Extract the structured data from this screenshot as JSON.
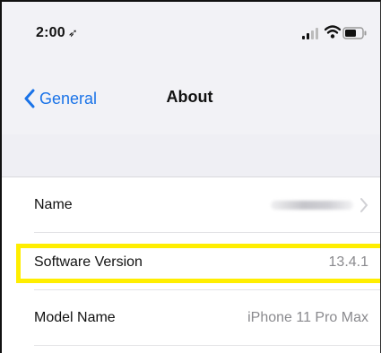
{
  "status_bar": {
    "time": "2:00",
    "location_arrow": "location-arrow-icon",
    "icons": [
      "signal-icon",
      "wifi-icon",
      "battery-icon"
    ]
  },
  "nav": {
    "back_label": "General",
    "title": "About"
  },
  "rows": [
    {
      "label": "Name",
      "value": "",
      "value_obscured": true
    },
    {
      "label": "Software Version",
      "value": "13.4.1"
    },
    {
      "label": "Model Name",
      "value": "iPhone 11 Pro Max"
    }
  ],
  "colors": {
    "accent": "#1a73e8",
    "highlight": "#ffee00",
    "grouped_background": "#efeff4",
    "secondary_text": "#8a8a8e"
  }
}
